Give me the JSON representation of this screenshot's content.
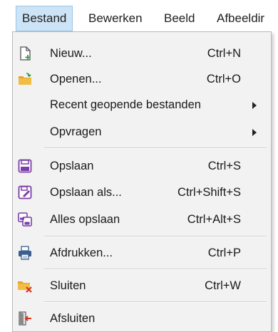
{
  "menubar": {
    "items": [
      {
        "label": "Bestand"
      },
      {
        "label": "Bewerken"
      },
      {
        "label": "Beeld"
      },
      {
        "label": "Afbeeldir"
      }
    ]
  },
  "file_menu": {
    "items": [
      {
        "label": "Nieuw...",
        "shortcut": "Ctrl+N",
        "icon": "new-file-icon"
      },
      {
        "label": "Openen...",
        "shortcut": "Ctrl+O",
        "icon": "open-folder-icon"
      },
      {
        "label": "Recent geopende bestanden",
        "icon": "submenu-arrow-icon"
      },
      {
        "label": "Opvragen",
        "icon": "submenu-arrow-icon"
      },
      {
        "label": "Opslaan",
        "shortcut": "Ctrl+S",
        "icon": "save-icon"
      },
      {
        "label": "Opslaan als...",
        "shortcut": "Ctrl+Shift+S",
        "icon": "save-as-icon"
      },
      {
        "label": "Alles opslaan",
        "shortcut": "Ctrl+Alt+S",
        "icon": "save-all-icon"
      },
      {
        "label": "Afdrukken...",
        "shortcut": "Ctrl+P",
        "icon": "printer-icon"
      },
      {
        "label": "Sluiten",
        "shortcut": "Ctrl+W",
        "icon": "close-folder-icon"
      },
      {
        "label": "Afsluiten",
        "icon": "exit-icon"
      }
    ]
  },
  "colors": {
    "active_highlight": "#cde4f7",
    "menu_background": "#f2f2f2",
    "save_icon_purple": "#7a3fa8",
    "folder_orange": "#e3a52a",
    "close_red": "#d9331f"
  }
}
